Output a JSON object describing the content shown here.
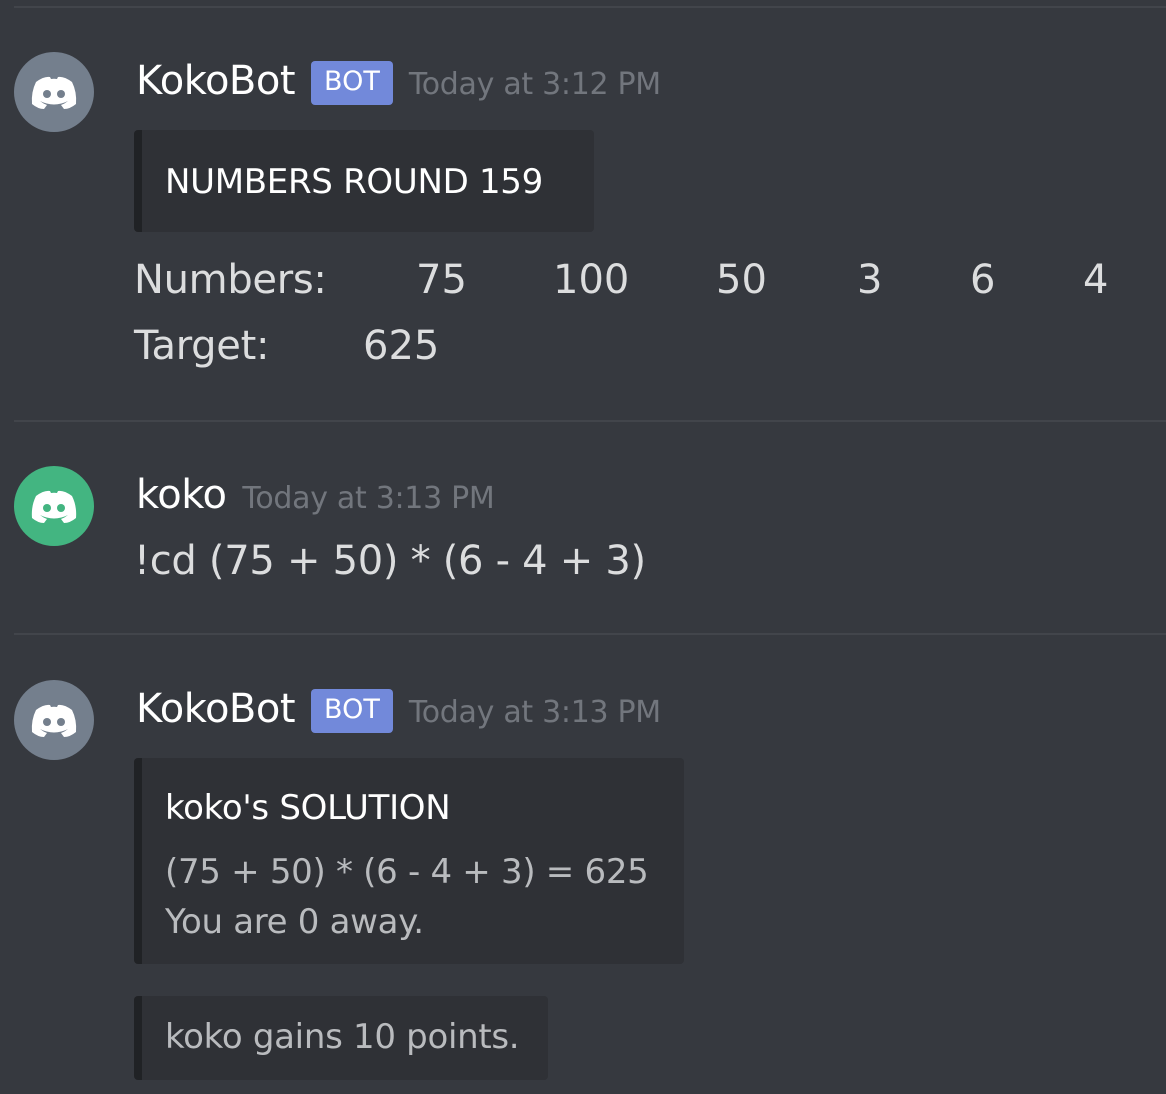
{
  "colors": {
    "background": "#36393f",
    "bot_tag": "#7289da",
    "bot_avatar": "#747f8d",
    "user_avatar": "#43b581",
    "embed_bg": "#2f3136",
    "timestamp": "#72767d"
  },
  "messages": [
    {
      "author": "KokoBot",
      "bot_tag": "BOT",
      "timestamp": "Today at 3:12 PM",
      "avatar_icon": "discord-logo-icon",
      "embed": {
        "title": "NUMBERS ROUND 159"
      },
      "numbers_label": "Numbers:",
      "numbers": [
        "75",
        "100",
        "50",
        "3",
        "6",
        "4"
      ],
      "target_label": "Target:",
      "target": "625"
    },
    {
      "author": "koko",
      "timestamp": "Today at 3:13 PM",
      "avatar_icon": "discord-logo-icon",
      "content": "!cd (75 + 50) * (6 - 4 + 3)"
    },
    {
      "author": "KokoBot",
      "bot_tag": "BOT",
      "timestamp": "Today at 3:13 PM",
      "avatar_icon": "discord-logo-icon",
      "embed": {
        "title": "koko's SOLUTION",
        "line1": "(75 + 50) * (6 - 4 + 3) = 625",
        "line2": "You are 0 away."
      },
      "embed2": {
        "text": "koko gains 10 points."
      }
    }
  ]
}
